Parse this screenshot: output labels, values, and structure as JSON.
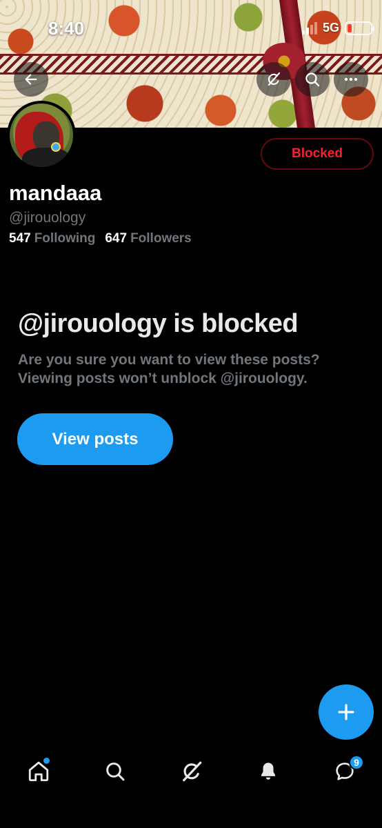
{
  "status_bar": {
    "time": "8:40",
    "network": "5G"
  },
  "header": {
    "back_icon": "arrow-left-icon",
    "grok_icon": "grok-icon",
    "search_icon": "search-icon",
    "more_icon": "more-horizontal-icon"
  },
  "profile": {
    "display_name": "mandaaa",
    "handle": "@jirouology",
    "following_count": "547",
    "following_label": "Following",
    "followers_count": "647",
    "followers_label": "Followers",
    "blocked_button_label": "Blocked"
  },
  "blocked_notice": {
    "title": "@jirouology is blocked",
    "description": "Are you sure you want to view these posts? Viewing posts won’t unblock @jirouology.",
    "view_posts_label": "View posts"
  },
  "bottom_nav": {
    "items": [
      {
        "name": "home",
        "icon": "home-icon",
        "has_dot": true
      },
      {
        "name": "search",
        "icon": "search-icon"
      },
      {
        "name": "grok",
        "icon": "grok-icon"
      },
      {
        "name": "notifications",
        "icon": "bell-icon"
      },
      {
        "name": "messages",
        "icon": "message-icon",
        "badge": "9"
      }
    ]
  },
  "colors": {
    "accent": "#1d9bf0",
    "blocked_red": "#f4212e",
    "muted_text": "#71767b",
    "background": "#000000"
  }
}
